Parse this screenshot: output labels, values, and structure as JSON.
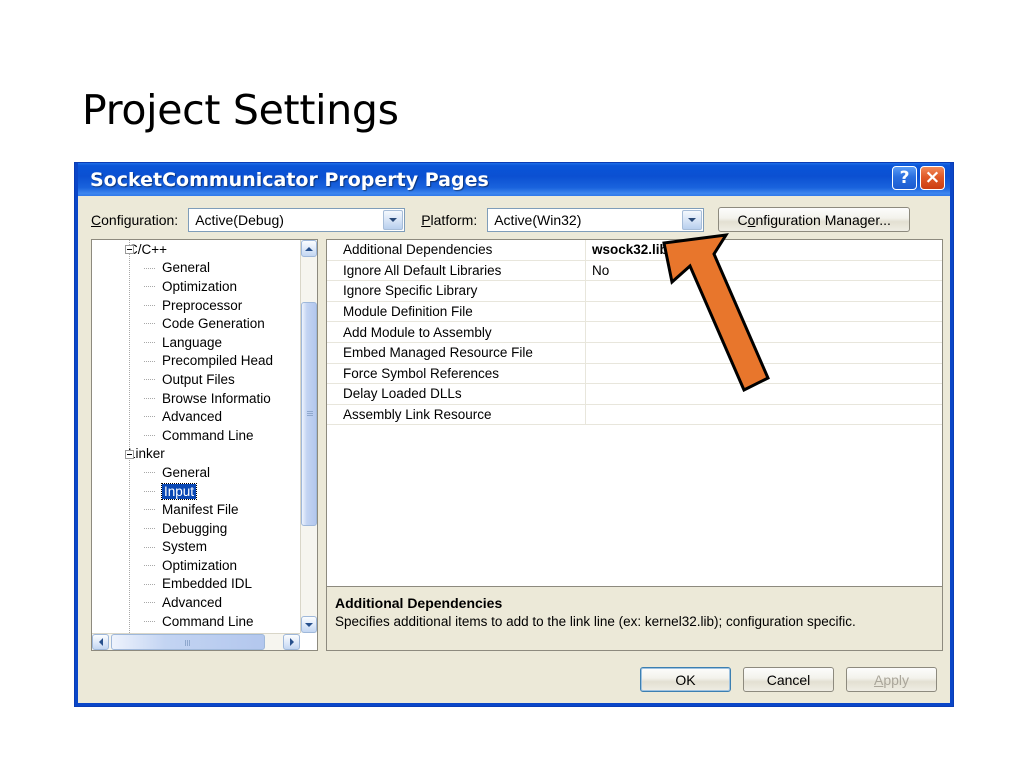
{
  "slide": {
    "title": "Project Settings"
  },
  "dialog": {
    "title": "SocketCommunicator Property Pages",
    "titlebar_buttons": [
      {
        "name": "help-button",
        "glyph": "?"
      },
      {
        "name": "close-button",
        "glyph": "×"
      }
    ],
    "config_bar": {
      "configuration_label": "Configuration:",
      "configuration_accel": "C",
      "configuration_value": "Active(Debug)",
      "platform_label": "Platform:",
      "platform_accel": "P",
      "platform_value": "Active(Win32)",
      "configuration_manager_label": "Configuration Manager...",
      "configuration_manager_accel": "o"
    },
    "tree": {
      "nodes": [
        {
          "label": "C/C++",
          "level": 0,
          "expanded": true,
          "selected": false
        },
        {
          "label": "General",
          "level": 1,
          "selected": false
        },
        {
          "label": "Optimization",
          "level": 1,
          "selected": false
        },
        {
          "label": "Preprocessor",
          "level": 1,
          "selected": false
        },
        {
          "label": "Code Generation",
          "level": 1,
          "selected": false
        },
        {
          "label": "Language",
          "level": 1,
          "selected": false
        },
        {
          "label": "Precompiled Head",
          "level": 1,
          "selected": false
        },
        {
          "label": "Output Files",
          "level": 1,
          "selected": false
        },
        {
          "label": "Browse Informatio",
          "level": 1,
          "selected": false
        },
        {
          "label": "Advanced",
          "level": 1,
          "selected": false
        },
        {
          "label": "Command Line",
          "level": 1,
          "selected": false
        },
        {
          "label": "Linker",
          "level": 0,
          "expanded": true,
          "selected": false
        },
        {
          "label": "General",
          "level": 1,
          "selected": false
        },
        {
          "label": "Input",
          "level": 1,
          "selected": true
        },
        {
          "label": "Manifest File",
          "level": 1,
          "selected": false
        },
        {
          "label": "Debugging",
          "level": 1,
          "selected": false
        },
        {
          "label": "System",
          "level": 1,
          "selected": false
        },
        {
          "label": "Optimization",
          "level": 1,
          "selected": false
        },
        {
          "label": "Embedded IDL",
          "level": 1,
          "selected": false
        },
        {
          "label": "Advanced",
          "level": 1,
          "selected": false
        },
        {
          "label": "Command Line",
          "level": 1,
          "selected": false
        }
      ]
    },
    "properties": {
      "rows": [
        {
          "name": "Additional Dependencies",
          "value": "wsock32.lib",
          "bold": true
        },
        {
          "name": "Ignore All Default Libraries",
          "value": "No",
          "bold": false
        },
        {
          "name": "Ignore Specific Library",
          "value": "",
          "bold": false
        },
        {
          "name": "Module Definition File",
          "value": "",
          "bold": false
        },
        {
          "name": "Add Module to Assembly",
          "value": "",
          "bold": false
        },
        {
          "name": "Embed Managed Resource File",
          "value": "",
          "bold": false
        },
        {
          "name": "Force Symbol References",
          "value": "",
          "bold": false
        },
        {
          "name": "Delay Loaded DLLs",
          "value": "",
          "bold": false
        },
        {
          "name": "Assembly Link Resource",
          "value": "",
          "bold": false
        }
      ],
      "description": {
        "title": "Additional Dependencies",
        "text": "Specifies additional items to add to the link line (ex: kernel32.lib); configuration specific."
      }
    },
    "buttons": {
      "ok": "OK",
      "cancel": "Cancel",
      "apply": "Apply",
      "apply_accel": "A",
      "apply_disabled": true
    }
  },
  "annotation": {
    "arrow_name": "orange-pointer-arrow",
    "arrow_color": "#E8762C",
    "arrow_outline": "#000000",
    "points_at": "wsock32.lib"
  },
  "colors": {
    "titlebar_blue": "#0B50D2",
    "dialog_face": "#ECE9D8",
    "selection_blue": "#0A48B5",
    "accent_orange": "#E8762C"
  }
}
